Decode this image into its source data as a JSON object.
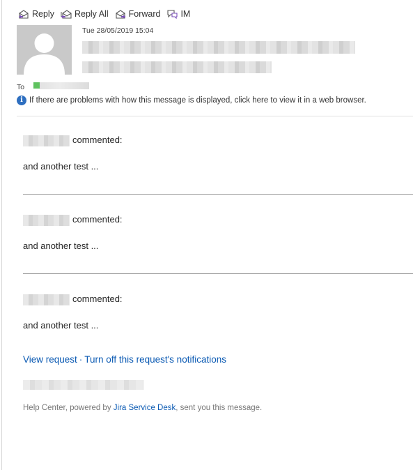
{
  "toolbar": {
    "reply": "Reply",
    "reply_all": "Reply All",
    "forward": "Forward",
    "im": "IM"
  },
  "header": {
    "date": "Tue 28/05/2019 15:04",
    "to_label": "To",
    "info_text": "If there are problems with how this message is displayed, click here to view it in a web browser."
  },
  "comments": [
    {
      "action": "commented:",
      "text": "and another test ..."
    },
    {
      "action": "commented:",
      "text": "and another test ..."
    },
    {
      "action": "commented:",
      "text": "and another test ..."
    }
  ],
  "links": {
    "view_request": "View request",
    "separator": "·",
    "turn_off": "Turn off this request's notifications"
  },
  "footer": {
    "prefix": "Help Center, powered by ",
    "link": "Jira Service Desk",
    "suffix": ", sent you this message."
  },
  "colors": {
    "link": "#0b5ab3",
    "info_icon": "#2e6fc0",
    "presence": "#5fc25f"
  }
}
